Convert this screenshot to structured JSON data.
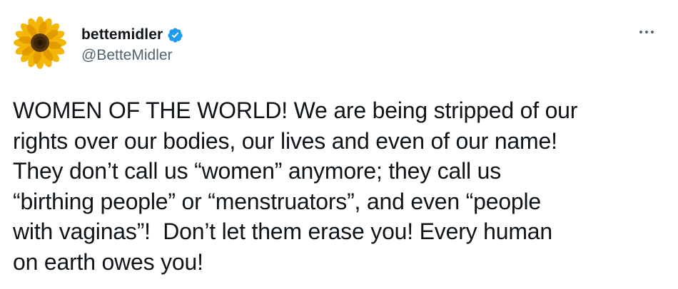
{
  "tweet": {
    "avatar_icon": "sunflower-avatar",
    "display_name": "bettemidler",
    "verified_icon": "verified-badge-icon",
    "handle": "@BetteMidler",
    "more_icon": "more-options-icon",
    "text": "WOMEN OF THE WORLD! We are being stripped of our\nrights over our bodies, our lives and even of our name!\nThey don’t call us “women” anymore; they call us\n“birthing people” or “menstruators”, and even “people\nwith vaginas”!  Don’t let them erase you! Every human\non earth owes you!"
  },
  "colors": {
    "text_primary": "#0f1419",
    "text_secondary": "#536471",
    "verified_blue": "#1d9bf0",
    "background": "#ffffff"
  }
}
